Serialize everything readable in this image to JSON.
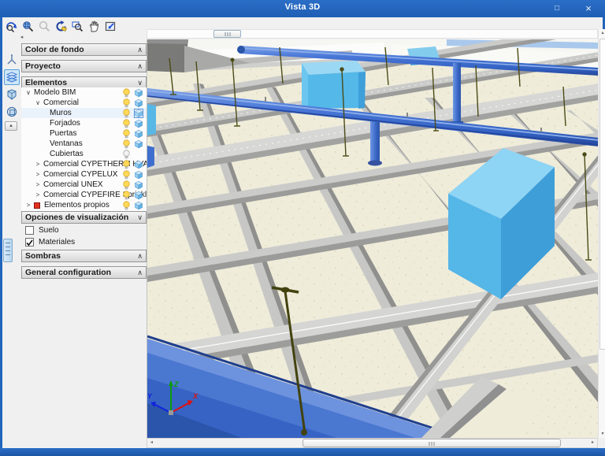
{
  "window": {
    "title": "Vista 3D",
    "maximize_glyph": "□",
    "close_glyph": "×"
  },
  "toolbar": {
    "items": [
      {
        "name": "zoom-previous"
      },
      {
        "name": "zoom-extents"
      },
      {
        "name": "zoom-inactive"
      },
      {
        "name": "rotate-view"
      },
      {
        "name": "zoom-window"
      },
      {
        "name": "pan-view"
      },
      {
        "name": "fit-window"
      }
    ]
  },
  "side_toolbar": {
    "items": [
      {
        "name": "axes-3d",
        "selected": false
      },
      {
        "name": "layer-visibility",
        "selected": true
      },
      {
        "name": "solid-view",
        "selected": false
      },
      {
        "name": "section-view",
        "selected": false
      },
      {
        "name": "more-tools",
        "selected": false,
        "glyph": "▴"
      }
    ]
  },
  "sidebar": {
    "panels": [
      {
        "id": "color-de-fondo",
        "label": "Color de fondo",
        "expanded": false
      },
      {
        "id": "proyecto",
        "label": "Proyecto",
        "expanded": false
      },
      {
        "id": "elementos",
        "label": "Elementos",
        "expanded": true
      },
      {
        "id": "opciones-visualizacion",
        "label": "Opciones de visualización",
        "expanded": true
      },
      {
        "id": "sombras",
        "label": "Sombras",
        "expanded": false
      },
      {
        "id": "general-configuration",
        "label": "General configuration",
        "expanded": false
      }
    ]
  },
  "tree": {
    "items": [
      {
        "label": "Modelo BIM",
        "level": 0,
        "expander": "expanded",
        "bulb": "on",
        "cube": "normal"
      },
      {
        "label": "Comercial",
        "level": 1,
        "expander": "expanded",
        "bulb": "on",
        "cube": "normal"
      },
      {
        "label": "Muros",
        "level": 2,
        "expander": "none",
        "bulb": "on",
        "cube": "outlined",
        "highlight": true
      },
      {
        "label": "Forjados",
        "level": 2,
        "expander": "none",
        "bulb": "on",
        "cube": "normal"
      },
      {
        "label": "Puertas",
        "level": 2,
        "expander": "none",
        "bulb": "on",
        "cube": "normal"
      },
      {
        "label": "Ventanas",
        "level": 2,
        "expander": "none",
        "bulb": "on",
        "cube": "normal"
      },
      {
        "label": "Cubiertas",
        "level": 2,
        "expander": "none",
        "bulb": "off",
        "cube": "none"
      },
      {
        "label": "Comercial CYPETHERM HVAC",
        "level": 1,
        "expander": "collapsed",
        "bulb": "on",
        "cube": "normal"
      },
      {
        "label": "Comercial CYPELUX",
        "level": 1,
        "expander": "collapsed",
        "bulb": "on",
        "cube": "normal"
      },
      {
        "label": "Comercial UNEX",
        "level": 1,
        "expander": "collapsed",
        "bulb": "on",
        "cube": "normal"
      },
      {
        "label": "Comercial CYPEFIRE Sprinklers",
        "level": 1,
        "expander": "collapsed",
        "bulb": "on",
        "cube": "normal"
      },
      {
        "label": "Elementos propios",
        "level": 0,
        "expander": "collapsed",
        "marker": "red-square",
        "bulb": "on",
        "cube": "normal"
      }
    ]
  },
  "visibility": {
    "options": [
      {
        "label": "Suelo",
        "checked": false
      },
      {
        "label": "Materiales",
        "checked": true
      }
    ]
  },
  "viewport": {
    "axes": {
      "x": "X",
      "y": "Y",
      "z": "Z"
    }
  },
  "scrollbars": {
    "left": "◂",
    "right": "▸",
    "up": "▴",
    "down": "▾"
  },
  "colors": {
    "titlebar": "#2165bd",
    "accent_blue": "#3f72d6",
    "cyan_box": "#5fc2ef",
    "floor": "#efecda",
    "sprinkler_olive": "#4b4b16",
    "bulb_yellow": "#ffd957"
  }
}
